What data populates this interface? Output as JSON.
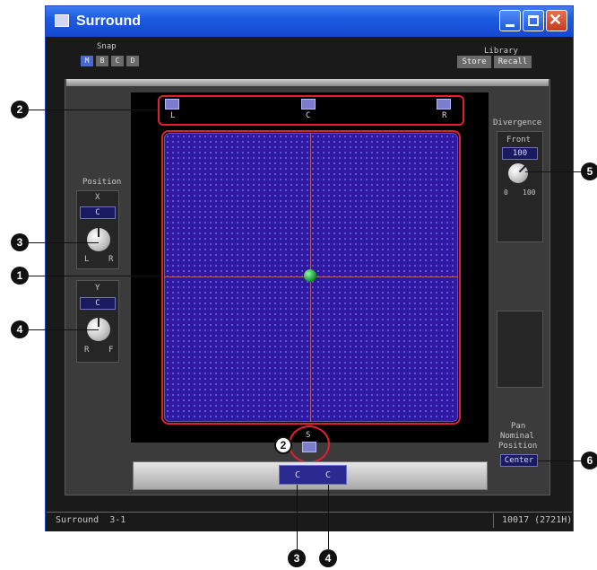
{
  "window": {
    "title": "Surround"
  },
  "snap": {
    "label": "Snap",
    "buttons": [
      "M",
      "B",
      "C",
      "D"
    ]
  },
  "library": {
    "label": "Library",
    "store": "Store",
    "recall": "Recall"
  },
  "speakers": {
    "left": "L",
    "center": "C",
    "right": "R",
    "surround": "S"
  },
  "position": {
    "title": "Position",
    "x_label": "X",
    "x_value": "C",
    "x_min": "L",
    "x_max": "R",
    "y_label": "Y",
    "y_value": "C",
    "y_min": "R",
    "y_max": "F"
  },
  "divergence": {
    "title": "Divergence",
    "front_label": "Front",
    "front_value": "100",
    "min": "0",
    "max": "100"
  },
  "pan": {
    "line1": "Pan",
    "line2": "Nominal",
    "line3": "Position",
    "value": "Center"
  },
  "bottom": {
    "val1": "C",
    "val2": "C"
  },
  "status": {
    "left": "Surround  3-1",
    "right": "10017 (2721H)"
  },
  "callouts": {
    "c1": "1",
    "c2": "2",
    "c3": "3",
    "c4": "4",
    "c5": "5",
    "c6": "6",
    "c2b": "2",
    "c3b": "3",
    "c4b": "4"
  }
}
